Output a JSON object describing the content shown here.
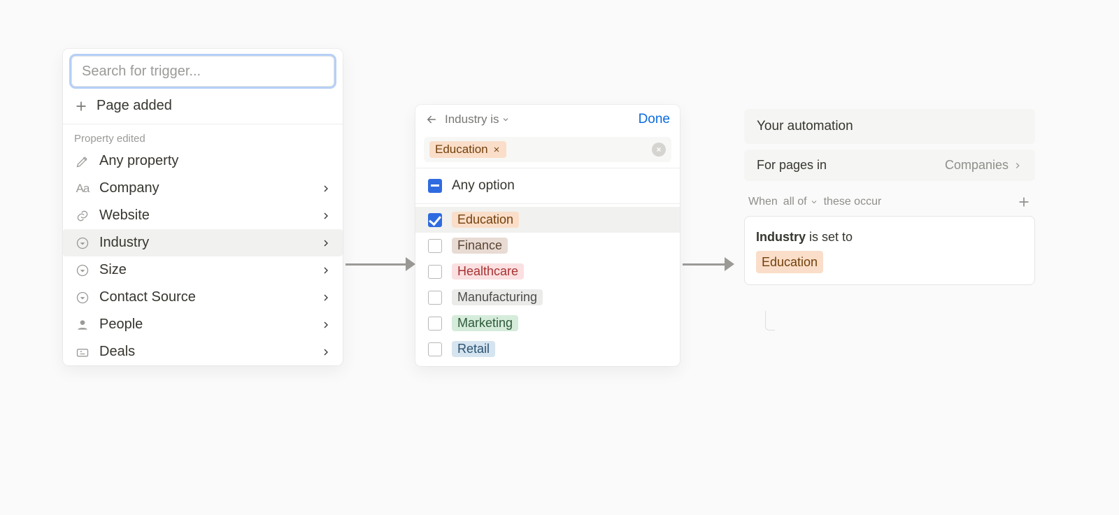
{
  "panel1": {
    "search_placeholder": "Search for trigger...",
    "trigger_label": "Page added",
    "section_label": "Property edited",
    "items": [
      {
        "label": "Any property",
        "icon": "edit"
      },
      {
        "label": "Company",
        "icon": "aa"
      },
      {
        "label": "Website",
        "icon": "link"
      },
      {
        "label": "Industry",
        "icon": "select"
      },
      {
        "label": "Size",
        "icon": "select"
      },
      {
        "label": "Contact Source",
        "icon": "select"
      },
      {
        "label": "People",
        "icon": "person"
      },
      {
        "label": "Deals",
        "icon": "deals"
      }
    ]
  },
  "panel2": {
    "crumb": "Industry is",
    "done": "Done",
    "selected_token": "Education",
    "any_option": "Any option",
    "options": [
      {
        "label": "Education",
        "css": "lab-education",
        "checked": true
      },
      {
        "label": "Finance",
        "css": "lab-finance",
        "checked": false
      },
      {
        "label": "Healthcare",
        "css": "lab-healthcare",
        "checked": false
      },
      {
        "label": "Manufacturing",
        "css": "lab-manufacturing",
        "checked": false
      },
      {
        "label": "Marketing",
        "css": "lab-marketing",
        "checked": false
      },
      {
        "label": "Retail",
        "css": "lab-retail",
        "checked": false
      }
    ]
  },
  "panel3": {
    "title": "Your automation",
    "for_label": "For pages in",
    "db_name": "Companies",
    "when_prefix": "When",
    "when_chip": "all of",
    "when_suffix": "these occur",
    "rule_property": "Industry",
    "rule_verb": "is set to",
    "rule_value": "Education"
  }
}
